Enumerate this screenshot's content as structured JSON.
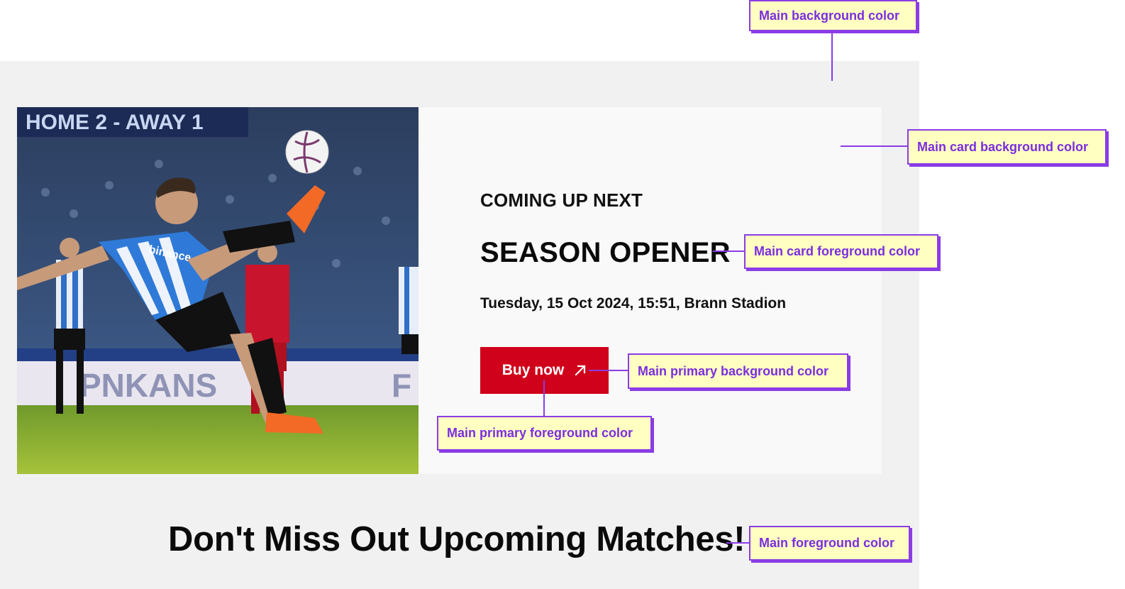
{
  "colors": {
    "main_background": "#f1f1f1",
    "main_card_background": "#f9f9f9",
    "main_card_foreground": "#0a0a0a",
    "main_primary_background": "#d0021b",
    "main_primary_foreground": "#ffffff",
    "main_foreground": "#0a0a0a",
    "annotation_fill": "#ffffc2",
    "annotation_accent": "#8a3ce6"
  },
  "card": {
    "image": {
      "description": "football-player-bicycle-kick-photo",
      "scoreboard_text": "HOME 2 - AWAY 1",
      "shirt_sponsor": "binance",
      "board_text_left": "PNKANS",
      "board_text_right": "F"
    },
    "eyebrow": "COMING UP NEXT",
    "title": "SEASON OPENER",
    "meta": "Tuesday, 15 Oct 2024, 15:51, Brann Stadion",
    "button": {
      "label": "Buy now",
      "icon": "arrow-up-right-icon"
    }
  },
  "section": {
    "heading": "Don't Miss Out Upcoming Matches!"
  },
  "annotations": {
    "main_background": "Main background color",
    "main_card_background": "Main card background color",
    "main_card_foreground": "Main card foreground color",
    "main_primary_background": "Main primary background color",
    "main_primary_foreground": "Main primary foreground color",
    "main_foreground": "Main foreground color"
  }
}
